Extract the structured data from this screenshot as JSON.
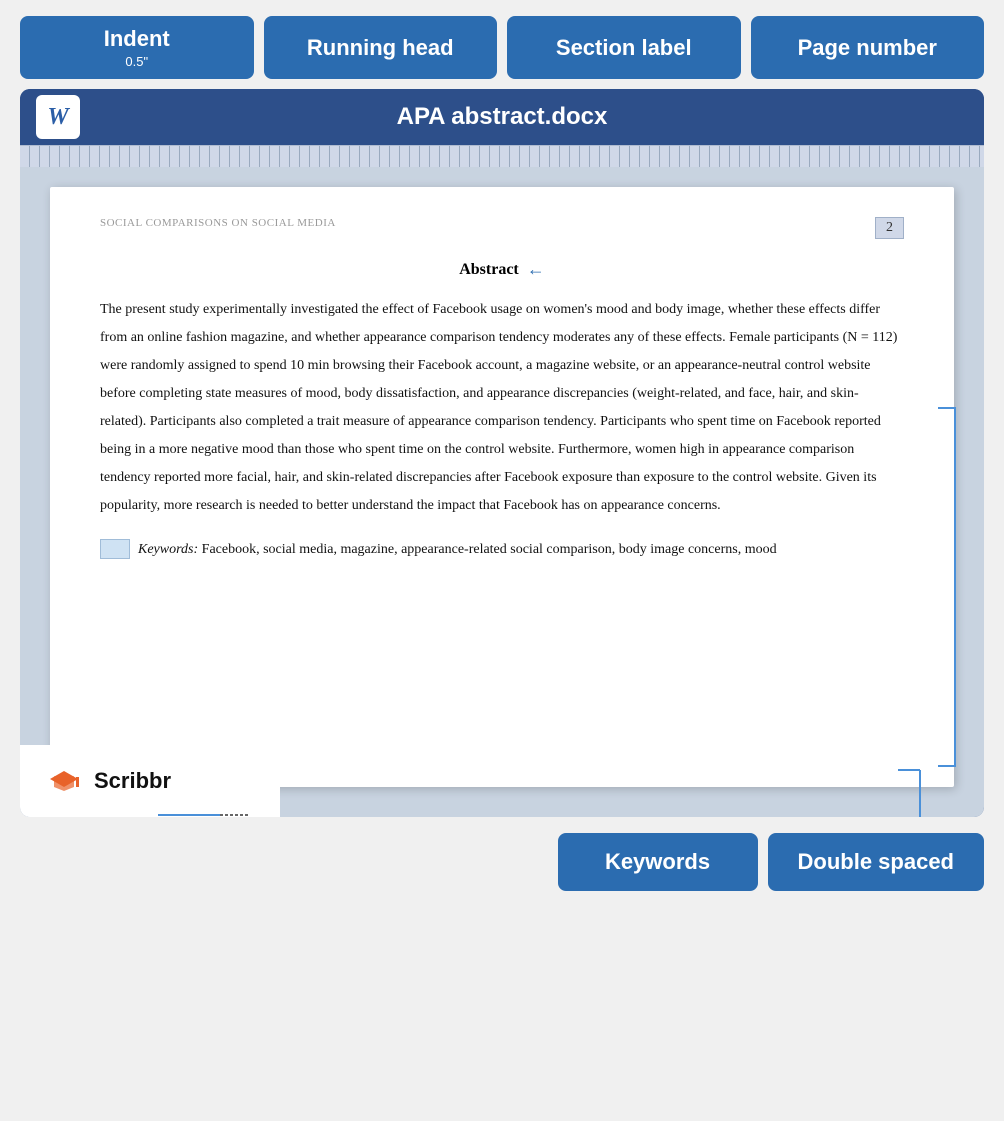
{
  "labels": {
    "indent": {
      "title": "Indent",
      "subtitle": "0.5\""
    },
    "running_head": {
      "title": "Running head"
    },
    "section_label": {
      "title": "Section label"
    },
    "page_number": {
      "title": "Page number"
    },
    "keywords": {
      "title": "Keywords"
    },
    "double_spaced": {
      "title": "Double spaced"
    }
  },
  "word": {
    "icon": "W",
    "title": "APA abstract.docx"
  },
  "document": {
    "running_head": "SOCIAL COMPARISONS ON SOCIAL MEDIA",
    "page_number": "2",
    "abstract_heading": "Abstract",
    "abstract_body": "The present study experimentally investigated the effect of Facebook usage on women's mood and body image, whether these effects differ from an online fashion magazine, and whether appearance comparison tendency moderates any of these effects. Female participants (N = 112) were randomly assigned to spend 10 min browsing their Facebook account, a magazine website, or an appearance-neutral control website before completing state measures of mood, body dissatisfaction, and appearance discrepancies (weight-related, and face, hair, and skin-related). Participants also completed a trait measure of appearance comparison tendency. Participants who spent time on Facebook reported being in a more negative mood than those who spent time on the control website. Furthermore, women high in appearance comparison tendency reported more facial, hair, and skin-related discrepancies after Facebook exposure than exposure to the control website. Given its popularity, more research is needed to better understand the impact that Facebook has on appearance concerns.",
    "keywords_label": "Keywords:",
    "keywords_text": " Facebook, social media, magazine, appearance-related social comparison, body image concerns, mood"
  },
  "scribbr": {
    "name": "Scribbr"
  }
}
